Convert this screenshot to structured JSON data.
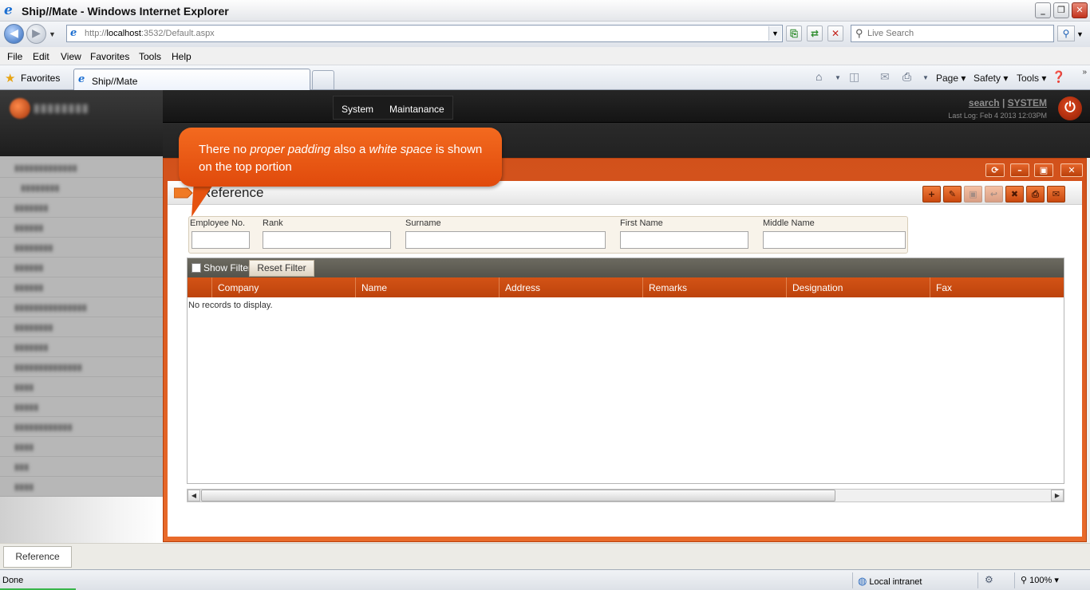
{
  "browser": {
    "window_title": "Ship//Mate - Windows Internet Explorer",
    "url_host": "http://",
    "url_main": "localhost",
    "url_rest": ":3532/Default.aspx",
    "search_placeholder": "Live Search",
    "menu": [
      "File",
      "Edit",
      "View",
      "Favorites",
      "Tools",
      "Help"
    ],
    "favorites_label": "Favorites",
    "tab_title": "Ship//Mate",
    "commands": {
      "page": "Page",
      "safety": "Safety",
      "tools": "Tools"
    },
    "status_text": "Done",
    "zone_text": "Local intranet",
    "zoom_text": "100%"
  },
  "app": {
    "nav_menu": [
      "System",
      "Maintanance"
    ],
    "links": {
      "search": "search",
      "separator": "|",
      "user": "SYSTEM"
    },
    "last_log": "Last Log: Feb 4 2013 12:03PM",
    "page_title": "Reference",
    "filters": [
      {
        "label": "Employee No.",
        "value": ""
      },
      {
        "label": "Rank",
        "value": ""
      },
      {
        "label": "Surname",
        "value": ""
      },
      {
        "label": "First Name",
        "value": ""
      },
      {
        "label": "Middle Name",
        "value": ""
      }
    ],
    "grid": {
      "show_filter_label": "Show Filter",
      "reset_filter_label": "Reset Filter",
      "columns": [
        "Company",
        "Name",
        "Address",
        "Remarks",
        "Designation",
        "Fax"
      ],
      "empty_message": "No records to display."
    },
    "bottom_tab": "Reference",
    "accent_color": "#d9531a"
  },
  "annotation": {
    "part1": "There no ",
    "em1": "proper padding",
    "part2": " also a ",
    "em2": "white space",
    "part3": " is shown on the top portion"
  }
}
